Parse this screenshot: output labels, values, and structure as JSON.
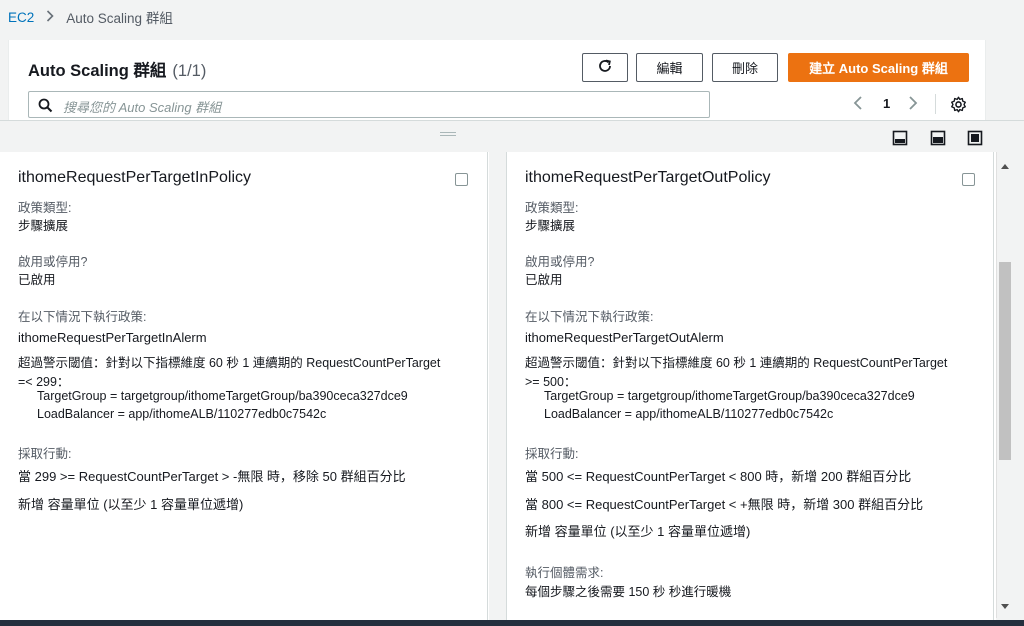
{
  "breadcrumb": {
    "root": "EC2",
    "current": "Auto Scaling 群組"
  },
  "header": {
    "title": "Auto Scaling 群組",
    "count": "(1/1)",
    "edit_label": "編輯",
    "delete_label": "刪除",
    "create_label": "建立 Auto Scaling 群組"
  },
  "search": {
    "placeholder": "搜尋您的 Auto Scaling 群組"
  },
  "pagination": {
    "page": "1"
  },
  "colors": {
    "accent": "#ec7211",
    "link": "#0073bb"
  },
  "icons": [
    "chevron-right-icon",
    "refresh-icon",
    "search-icon",
    "chevron-left-icon",
    "gear-icon",
    "drag-handle-icon",
    "panel-bottom-icon",
    "panel-side-icon",
    "panel-full-icon"
  ],
  "left_policy": {
    "name": "ithomeRequestPerTargetInPolicy",
    "type_label": "政策類型:",
    "type_value": "步驟擴展",
    "enabled_label": "啟用或停用?",
    "enabled_value": "已啟用",
    "exec_label": "在以下情況下執行政策:",
    "alarm_name": "ithomeRequestPerTargetInAlerm",
    "threshold_line1": "超過警示閾值：針對以下指標維度 60 秒 1 連續期的 RequestCountPerTarget",
    "threshold_line2": "=< 299：",
    "dimension_1": "TargetGroup = targetgroup/ithomeTargetGroup/ba390ceca327dce9",
    "dimension_2": "LoadBalancer = app/ithomeALB/110277edb0c7542c",
    "action_label": "採取行動:",
    "step_1": "當 299 >= RequestCountPerTarget > -無限 時，移除 50 群組百分比",
    "unit_note": "新增 容量單位 (以至少 1 容量單位遞增)"
  },
  "right_policy": {
    "name": "ithomeRequestPerTargetOutPolicy",
    "type_label": "政策類型:",
    "type_value": "步驟擴展",
    "enabled_label": "啟用或停用?",
    "enabled_value": "已啟用",
    "exec_label": "在以下情況下執行政策:",
    "alarm_name": "ithomeRequestPerTargetOutAlerm",
    "threshold_line1": "超過警示閾值：針對以下指標維度 60 秒 1 連續期的 RequestCountPerTarget",
    "threshold_line2": ">= 500：",
    "dimension_1": "TargetGroup = targetgroup/ithomeTargetGroup/ba390ceca327dce9",
    "dimension_2": "LoadBalancer = app/ithomeALB/110277edb0c7542c",
    "action_label": "採取行動:",
    "step_1": "當 500 <= RequestCountPerTarget < 800 時，新增 200 群組百分比",
    "step_2": "當 800 <= RequestCountPerTarget < +無限 時，新增 300 群組百分比",
    "unit_note": "新增 容量單位 (以至少 1 容量單位遞增)",
    "warmup_label": "執行個體需求:",
    "warmup_value": "每個步驟之後需要 150 秒 秒進行暖機"
  }
}
